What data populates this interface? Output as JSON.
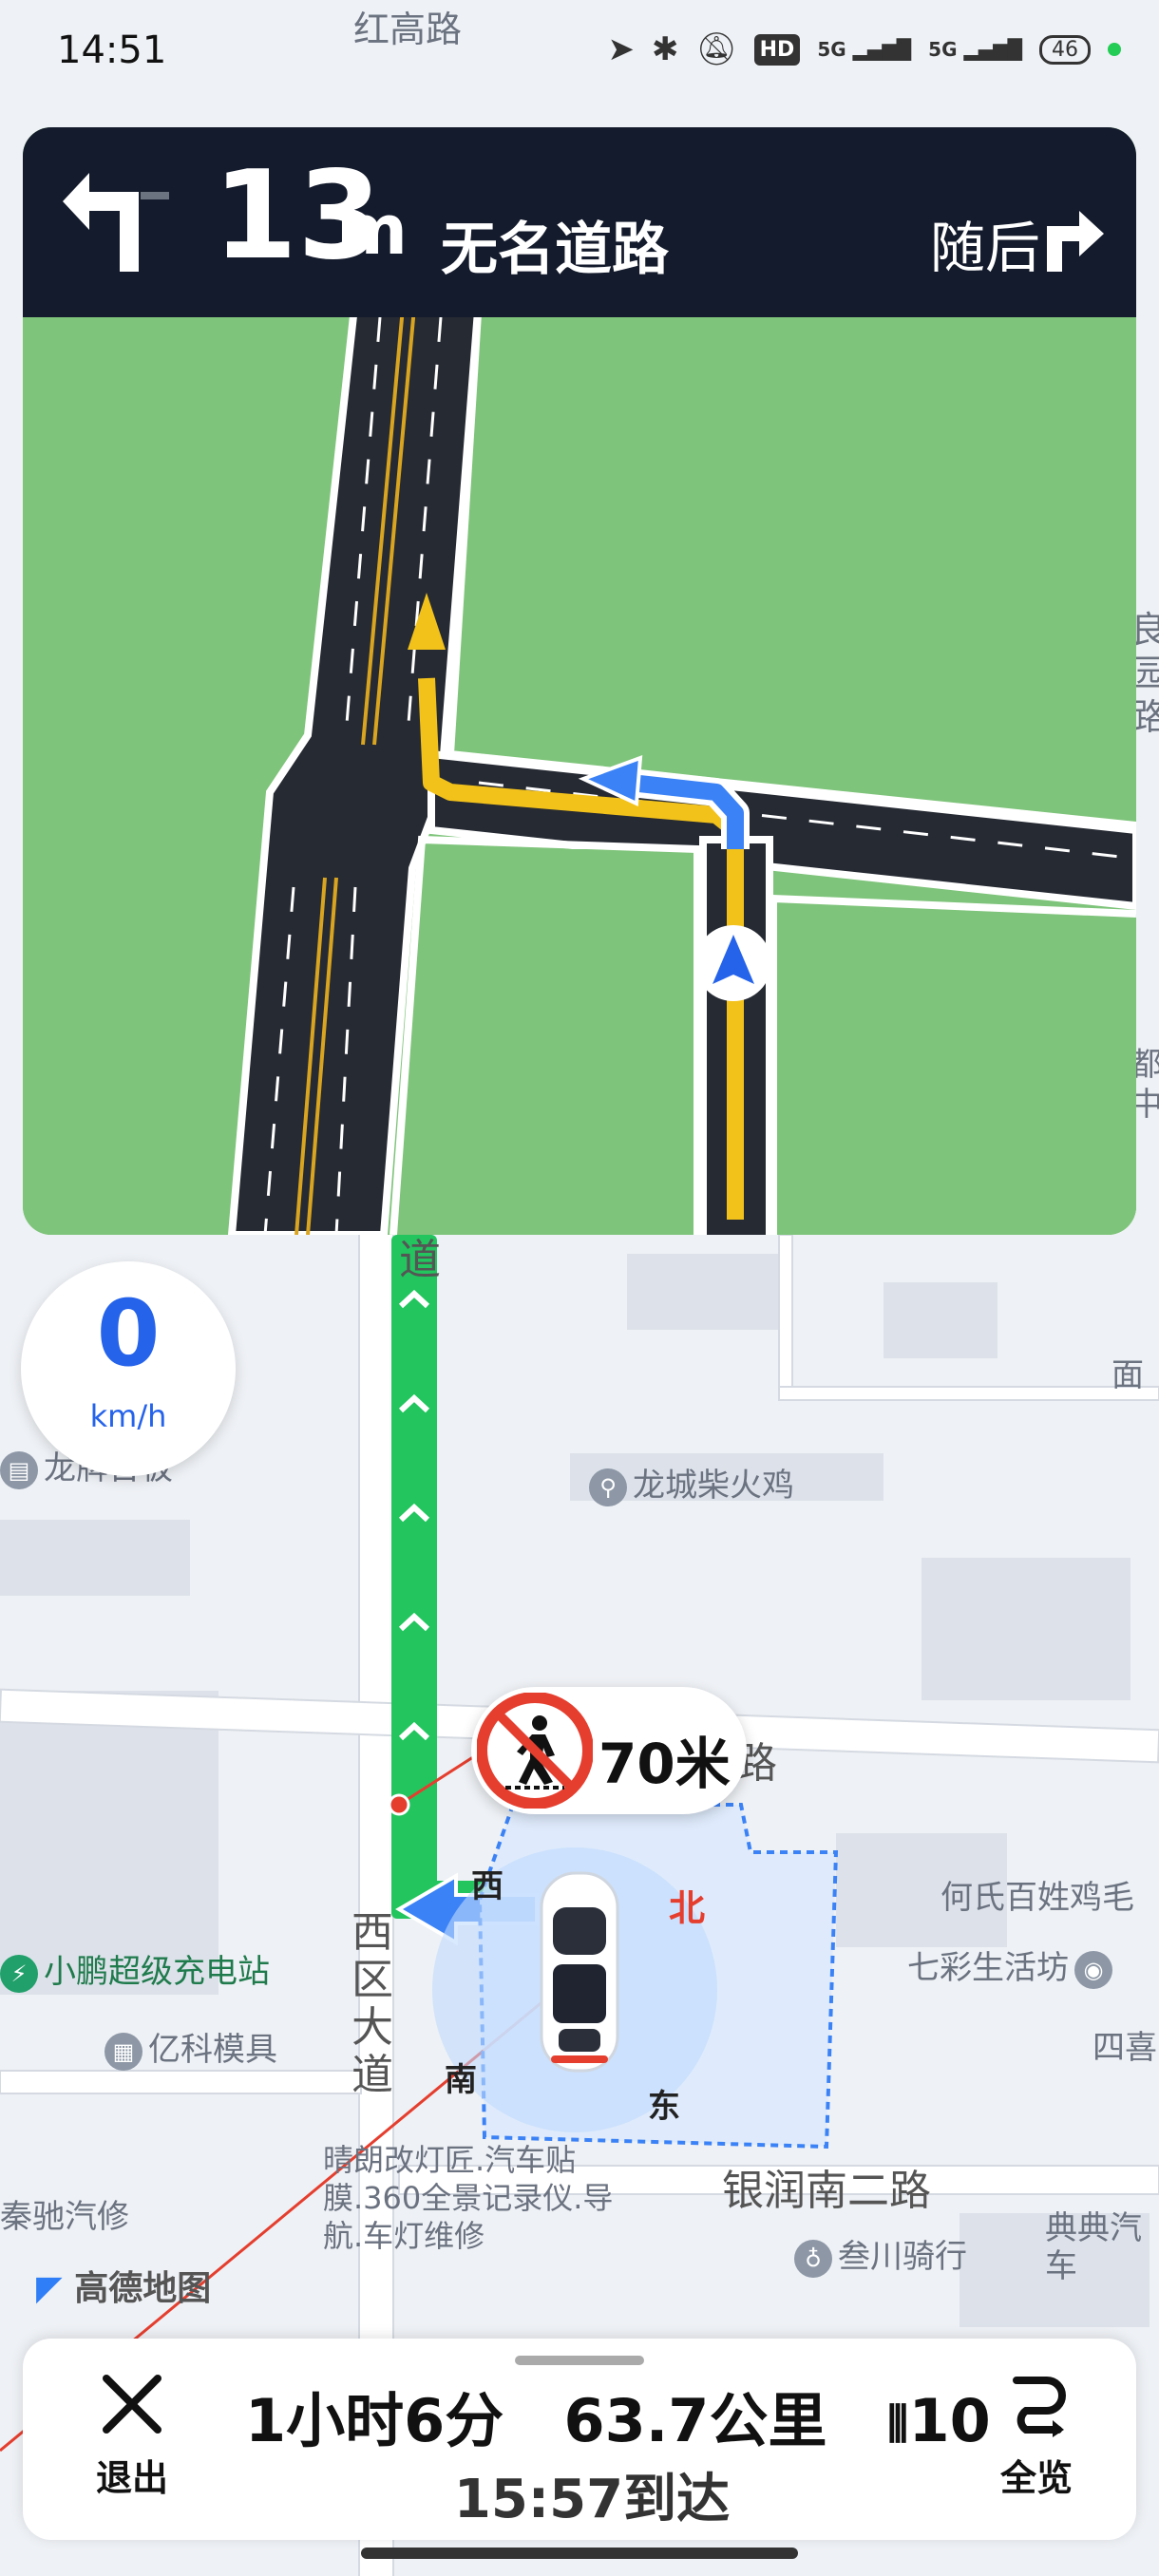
{
  "status_bar": {
    "time": "14:51",
    "hd": "HD",
    "net1": "5G",
    "net2": "5G",
    "battery": "46"
  },
  "map": {
    "road_top": "红高路",
    "poi_longcheng": "龙城柴火鸡",
    "poi_longpai": "龙牌台板",
    "poi_mian": "面",
    "poi_xiaopeng": "小鹏超级充电站",
    "poi_yike": "亿科模具",
    "poi_he": "何氏百姓鸡毛",
    "poi_qicai": "七彩生活坊",
    "poi_sijiu": "四喜",
    "poi_qinchi": "秦驰汽修",
    "poi_qinglang": "晴朗改灯匠.汽车贴膜.360全景记录仪.导航.车灯维修",
    "road_yinrun": "银润南二路",
    "poi_sanchuan": "叁川骑行",
    "poi_dianxian": "典典汽车",
    "road_xiqu": "西区大道",
    "road_lu": "路",
    "road_dao": "道",
    "dir_west": "西",
    "dir_north": "北",
    "dir_south": "南",
    "dir_east": "东",
    "logo": "高德地图",
    "side_right_1": "都中",
    "side_right_2": "良园路"
  },
  "navigation": {
    "distance_value": "13",
    "distance_unit": "m",
    "road_name": "无名道路",
    "then_label": "随后",
    "turn_icon": "turn-left-icon",
    "next_icon": "turn-right-icon"
  },
  "speed": {
    "value": "0",
    "unit": "km/h"
  },
  "alert": {
    "distance": "70米",
    "icon": "pedestrian-crossing-icon"
  },
  "bottom_bar": {
    "exit_label": "退出",
    "trip_time": "1小时6分",
    "trip_distance": "63.7公里",
    "traffic_lights": "10",
    "arrival": "15:57到达",
    "overview_label": "全览"
  },
  "colors": {
    "route_green": "#22c55e",
    "nav_header": "#141b2c",
    "lane_green": "#7ec47a",
    "accent_blue": "#2563eb",
    "warn_red": "#e53e2e"
  }
}
